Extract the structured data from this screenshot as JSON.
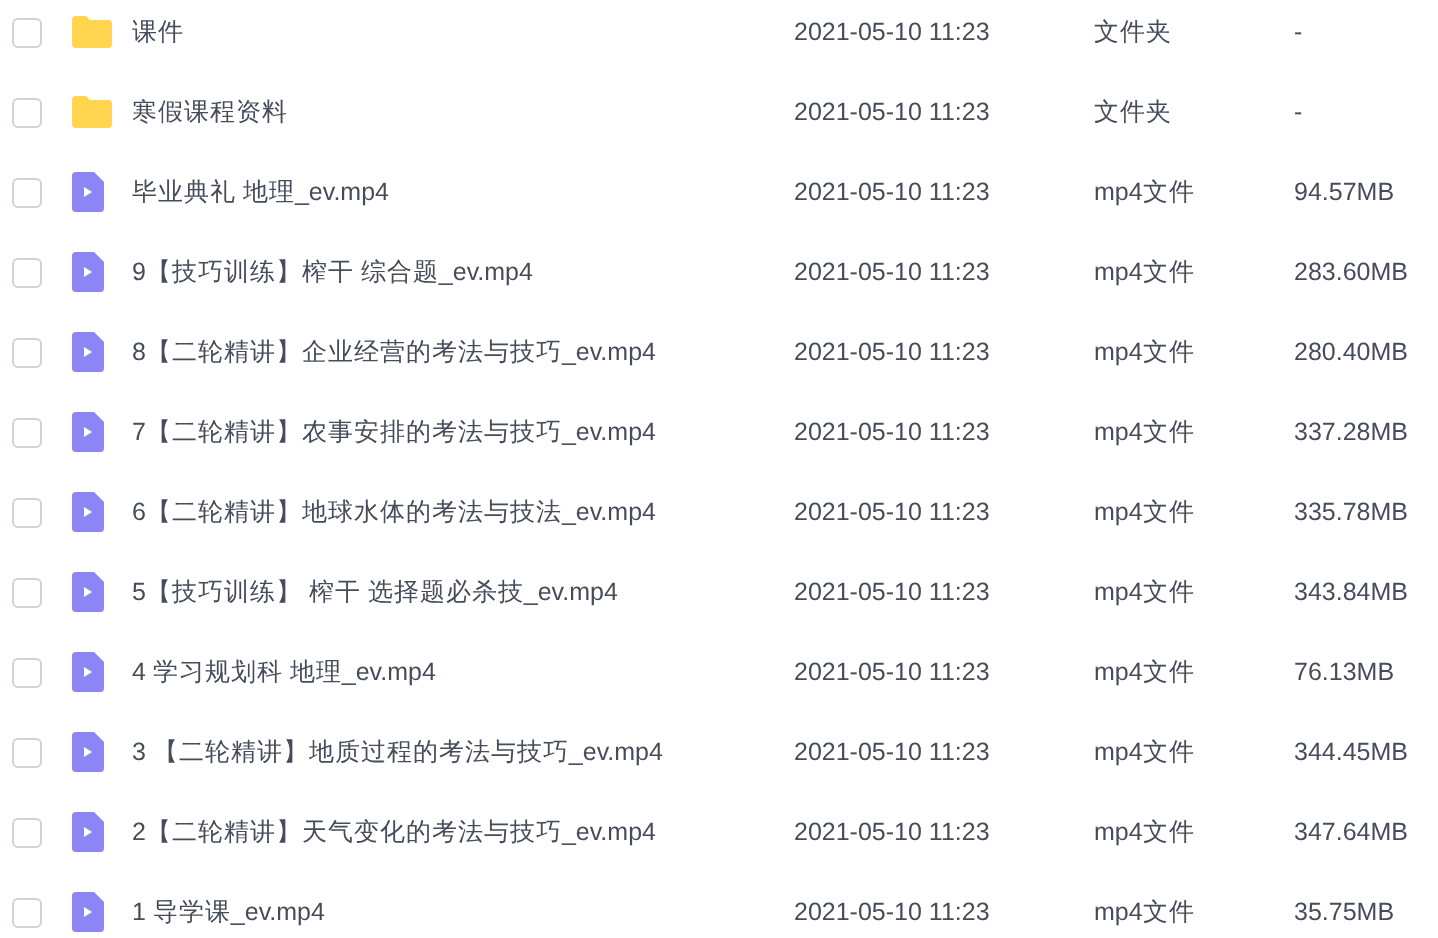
{
  "files": [
    {
      "kind": "folder",
      "checked": false,
      "name": "课件",
      "modified": "2021-05-10 11:23",
      "type": "文件夹",
      "size": "-"
    },
    {
      "kind": "folder",
      "checked": false,
      "name": "寒假课程资料",
      "modified": "2021-05-10 11:23",
      "type": "文件夹",
      "size": "-"
    },
    {
      "kind": "video",
      "checked": false,
      "name": "毕业典礼 地理_ev.mp4",
      "modified": "2021-05-10 11:23",
      "type": "mp4文件",
      "size": "94.57MB"
    },
    {
      "kind": "video",
      "checked": false,
      "name": "9【技巧训练】榨干 综合题_ev.mp4",
      "modified": "2021-05-10 11:23",
      "type": "mp4文件",
      "size": "283.60MB"
    },
    {
      "kind": "video",
      "checked": false,
      "name": "8【二轮精讲】企业经营的考法与技巧_ev.mp4",
      "modified": "2021-05-10 11:23",
      "type": "mp4文件",
      "size": "280.40MB"
    },
    {
      "kind": "video",
      "checked": false,
      "name": "7【二轮精讲】农事安排的考法与技巧_ev.mp4",
      "modified": "2021-05-10 11:23",
      "type": "mp4文件",
      "size": "337.28MB"
    },
    {
      "kind": "video",
      "checked": false,
      "name": "6【二轮精讲】地球水体的考法与技法_ev.mp4",
      "modified": "2021-05-10 11:23",
      "type": "mp4文件",
      "size": "335.78MB"
    },
    {
      "kind": "video",
      "checked": false,
      "name": "5【技巧训练】 榨干 选择题必杀技_ev.mp4",
      "modified": "2021-05-10 11:23",
      "type": "mp4文件",
      "size": "343.84MB"
    },
    {
      "kind": "video",
      "checked": false,
      "name": "4 学习规划科 地理_ev.mp4",
      "modified": "2021-05-10 11:23",
      "type": "mp4文件",
      "size": "76.13MB"
    },
    {
      "kind": "video",
      "checked": false,
      "name": "3 【二轮精讲】地质过程的考法与技巧_ev.mp4",
      "modified": "2021-05-10 11:23",
      "type": "mp4文件",
      "size": "344.45MB"
    },
    {
      "kind": "video",
      "checked": false,
      "name": "2【二轮精讲】天气变化的考法与技巧_ev.mp4",
      "modified": "2021-05-10 11:23",
      "type": "mp4文件",
      "size": "347.64MB"
    },
    {
      "kind": "video",
      "checked": false,
      "name": "1 导学课_ev.mp4",
      "modified": "2021-05-10 11:23",
      "type": "mp4文件",
      "size": "35.75MB"
    }
  ]
}
